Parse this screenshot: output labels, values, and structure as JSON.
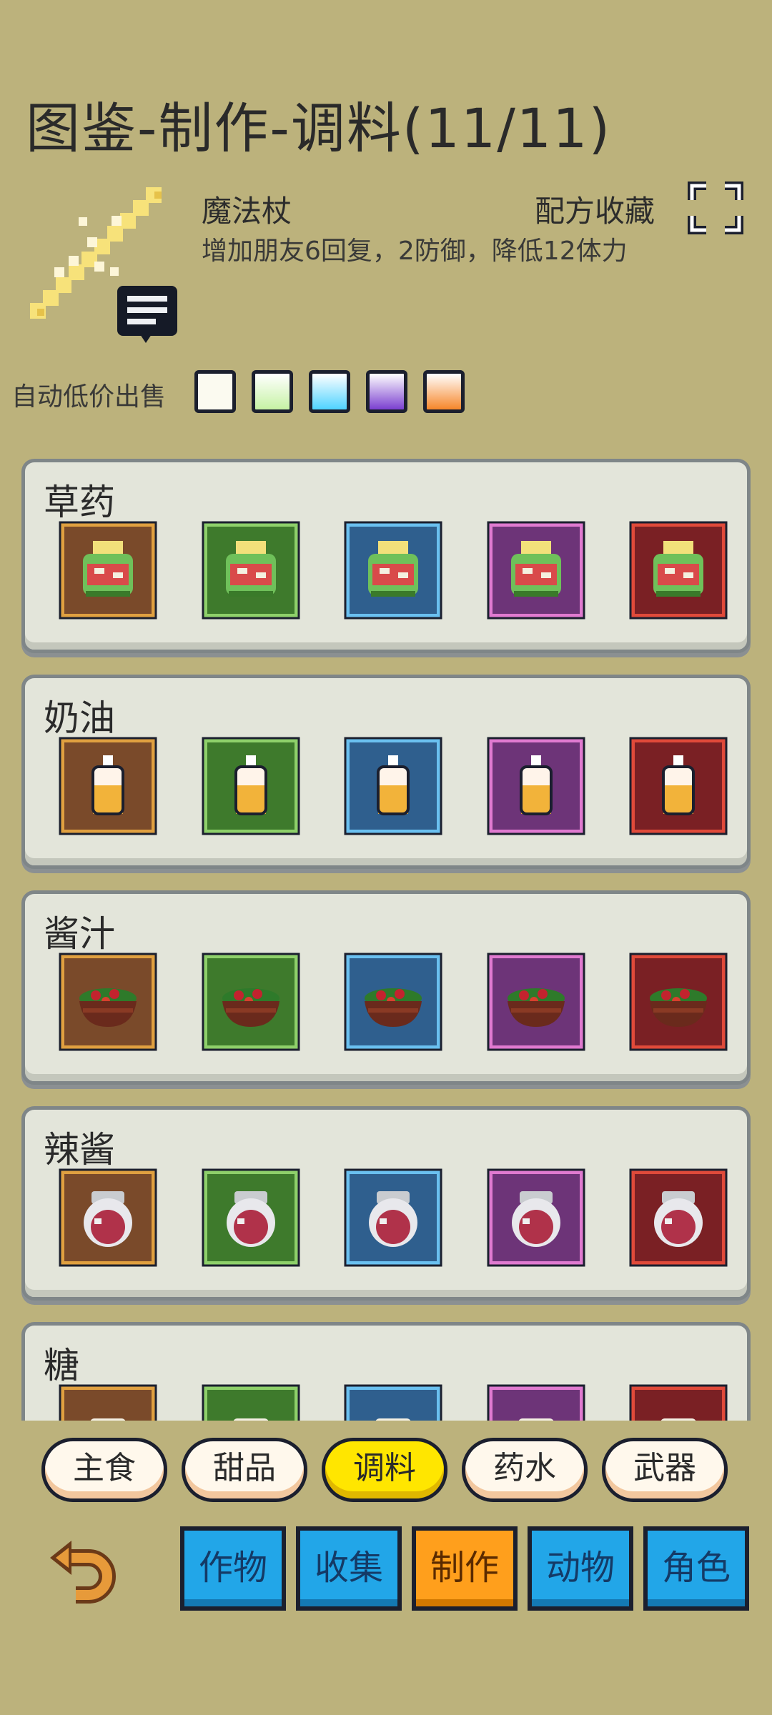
{
  "title": "图鉴-制作-调料(11/11)",
  "item": {
    "name": "魔法杖",
    "description": "增加朋友6回复，2防御，降低12体力",
    "favorite_label": "配方收藏"
  },
  "auto_sell": {
    "label": "自动低价出售",
    "swatches": [
      "#fbfaf0",
      "#c6f2a4",
      "#4fd3ff",
      "#7a3fd0",
      "#f6862a"
    ]
  },
  "tiers": [
    {
      "bg": "#7a4a2a",
      "border": "#e0a040"
    },
    {
      "bg": "#3e7a2c",
      "border": "#8ed06a"
    },
    {
      "bg": "#2f5f8e",
      "border": "#6ac0f0"
    },
    {
      "bg": "#6d3478",
      "border": "#e07ad0"
    },
    {
      "bg": "#7a2024",
      "border": "#e04a3a"
    }
  ],
  "categories": [
    {
      "name": "草药",
      "icon": "herb-icon"
    },
    {
      "name": "奶油",
      "icon": "cream-bottle-icon"
    },
    {
      "name": "酱汁",
      "icon": "sauce-bowl-icon"
    },
    {
      "name": "辣酱",
      "icon": "hot-sauce-jar-icon"
    },
    {
      "name": "糖",
      "icon": "sugar-icon"
    }
  ],
  "tabs": [
    "主食",
    "甜品",
    "调料",
    "药水",
    "武器"
  ],
  "active_tab": "调料",
  "nav": [
    "作物",
    "收集",
    "制作",
    "动物",
    "角色"
  ],
  "active_nav": "制作"
}
